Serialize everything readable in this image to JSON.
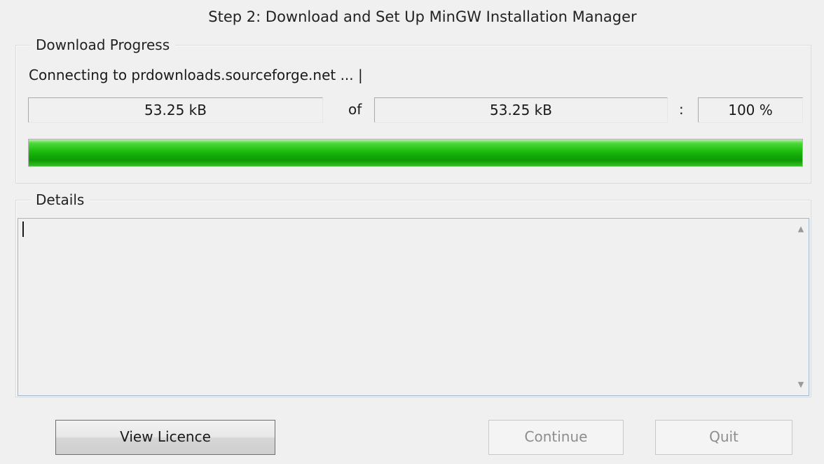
{
  "window": {
    "step_title": "Step 2: Download and Set Up MinGW Installation Manager"
  },
  "download_progress": {
    "legend": "Download Progress",
    "status": "Connecting to prdownloads.sourceforge.net ... |",
    "downloaded": "53.25 kB",
    "of_label": "of",
    "total": "53.25 kB",
    "colon_label": ":",
    "percent_text": "100 %",
    "progress_fraction": 1.0,
    "progress_color": "#1fbf0e"
  },
  "details": {
    "legend": "Details",
    "content": ""
  },
  "buttons": {
    "view_licence": "View Licence",
    "continue": "Continue",
    "quit": "Quit"
  }
}
